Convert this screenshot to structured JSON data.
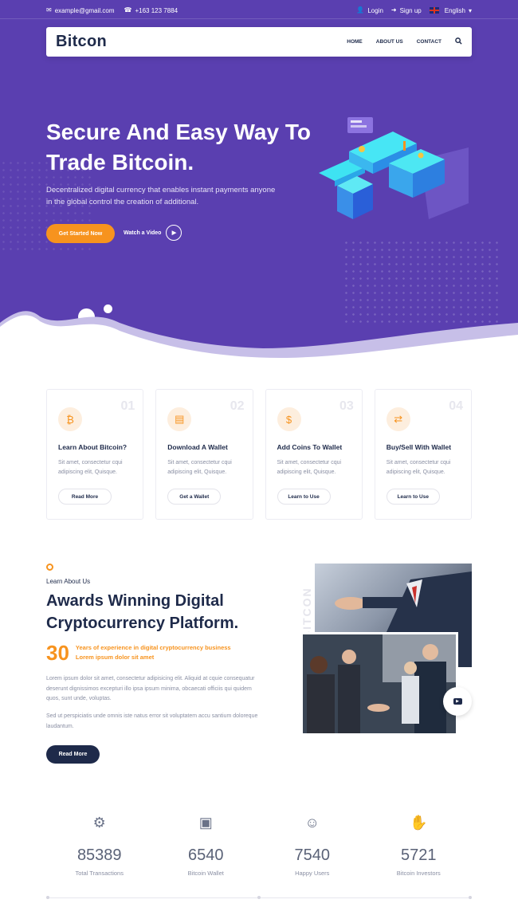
{
  "topbar": {
    "email": "example@gmail.com",
    "phone": "+163 123 7884",
    "login": "Login",
    "signup": "Sign up",
    "language": "English"
  },
  "nav": {
    "logo": "Bitcon",
    "links": [
      "HOME",
      "ABOUT US",
      "CONTACT"
    ]
  },
  "hero": {
    "title": "Secure And Easy Way To Trade Bitcoin.",
    "subtitle": "Decentralized digital currency that enables instant payments anyone in the global control the creation of additional.",
    "cta": "Get Started Now",
    "video": "Watch a Video"
  },
  "features": [
    {
      "num": "01",
      "title": "Learn About Bitcoin?",
      "text": "Sit amet, consectetur cqui adipiscing elit, Quisque.",
      "button": "Read More",
      "icon": "bitcoin-icon"
    },
    {
      "num": "02",
      "title": "Download A Wallet",
      "text": "Sit amet, consectetur cqui adipiscing elit, Quisque.",
      "button": "Get a Wallet",
      "icon": "wallet-icon"
    },
    {
      "num": "03",
      "title": "Add Coins To Wallet",
      "text": "Sit amet, consectetur cqui adipiscing elit, Quisque.",
      "button": "Learn to Use",
      "icon": "coin-bag-icon"
    },
    {
      "num": "04",
      "title": "Buy/Sell With Wallet",
      "text": "Sit amet, consectetur cqui adipiscing elit, Quisque.",
      "button": "Learn to Use",
      "icon": "exchange-icon"
    }
  ],
  "about": {
    "kicker": "Learn About Us",
    "title": "Awards Winning Digital Cryptocurrency Platform.",
    "years_num": "30",
    "years_text_1": "Years of experience in digital cryptocurrency business",
    "years_text_2": "Lorem ipsum dolor sit amet",
    "p1": "Lorem ipsum dolor sit amet, consectetur adipisicing elit. Aliquid at cquie consequatur deserunt dignissimos excepturi illo ipsa ipsum minima, obcaecati officiis qui quidem quos, sunt unde, voluptas.",
    "p2": "Sed ut perspiciatis unde omnis iste natus error sit voluptatem accu santium doloreque laudantum.",
    "button": "Read More",
    "vertical_text": "BITCON"
  },
  "stats": [
    {
      "value": "85389",
      "label": "Total Transactions",
      "icon": "gear-icon"
    },
    {
      "value": "6540",
      "label": "Bitcoin Wallet",
      "icon": "wallet-icon"
    },
    {
      "value": "7540",
      "label": "Happy Users",
      "icon": "users-icon"
    },
    {
      "value": "5721",
      "label": "Bitcoin Investors",
      "icon": "investor-icon"
    }
  ],
  "colors": {
    "hero_bg": "#5a3fb0",
    "accent": "#f7931e",
    "navy": "#1e2a4a"
  }
}
